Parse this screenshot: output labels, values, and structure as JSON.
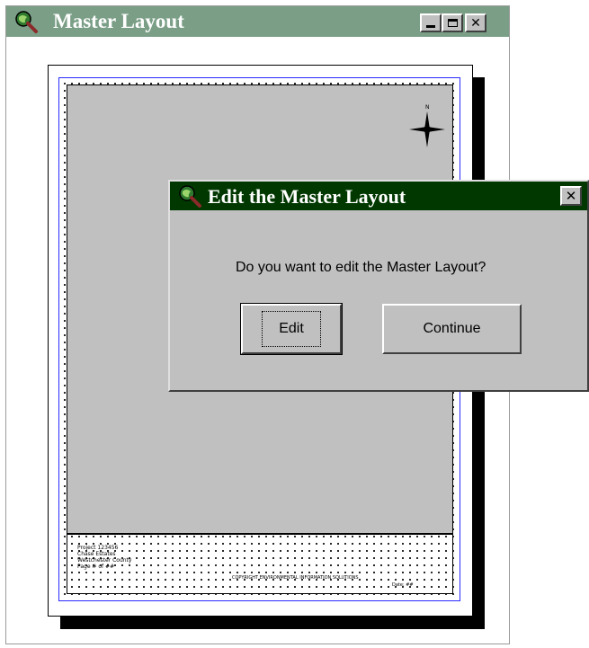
{
  "main_window": {
    "title": "Master Layout",
    "icon": "globe-magnifier-icon",
    "controls": {
      "minimize": "minimize-icon",
      "maximize": "maximize-icon",
      "close": "✕"
    }
  },
  "layout_page": {
    "north_arrow_label": "N",
    "title_block": {
      "line1": "Project 123456",
      "line2": "Chase Estates",
      "line3": "Westchester County",
      "line4": "Page # of ##",
      "center_text": "COPYRIGHT ENVIRONMENTAL INFORMATION SOLUTIONS",
      "right_text": "Date: ##"
    }
  },
  "dialog": {
    "title": "Edit the Master Layout",
    "icon": "globe-magnifier-icon",
    "close_label": "✕",
    "message": "Do you want to edit the Master Layout?",
    "buttons": {
      "edit": "Edit",
      "continue": "Continue"
    }
  },
  "colors": {
    "main_titlebar": "#7a9e86",
    "dialog_titlebar": "#003800",
    "face": "#c0c0c0",
    "page_outline": "#2a2aff"
  }
}
